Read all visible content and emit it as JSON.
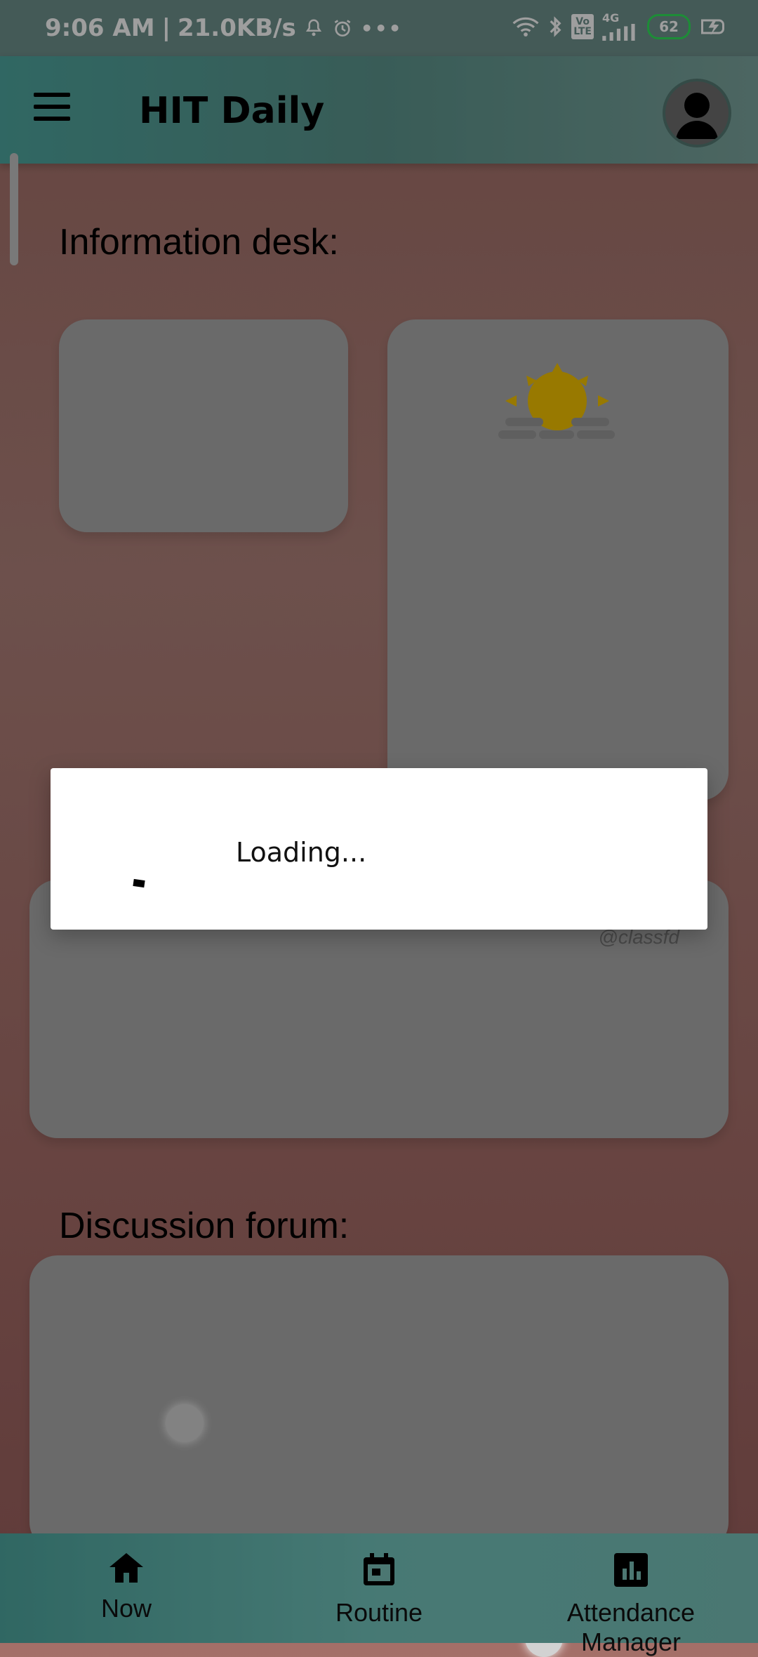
{
  "status_bar": {
    "time": "9:06 AM",
    "separator": "|",
    "network_speed": "21.0KB/s",
    "volte_line1": "Vo",
    "volte_line2": "LTE",
    "network_type": "4G",
    "battery": "62",
    "icons": [
      "notification-bell-icon",
      "alarm-icon",
      "more-dots-icon",
      "wifi-icon",
      "bluetooth-icon",
      "signal-icon",
      "charging-icon"
    ]
  },
  "app_bar": {
    "title": "HIT Daily",
    "menu_icon": "menu-icon",
    "avatar_icon": "profile-avatar-icon"
  },
  "content": {
    "information_desk_title": "Information desk:",
    "discussion_forum_title": "Discussion forum:",
    "card_handle": "@classfd"
  },
  "dialog": {
    "text": "Loading..."
  },
  "bottom_nav": {
    "items": [
      {
        "label": "Now",
        "icon": "home-icon"
      },
      {
        "label": "Routine",
        "icon": "calendar-icon"
      },
      {
        "label": "Attendance Manager",
        "icon": "bar-chart-icon"
      }
    ]
  },
  "colors": {
    "app_bar": "#4ea7a0",
    "background": "#a46f68",
    "card": "#ababab",
    "sun": "#f5c400"
  }
}
